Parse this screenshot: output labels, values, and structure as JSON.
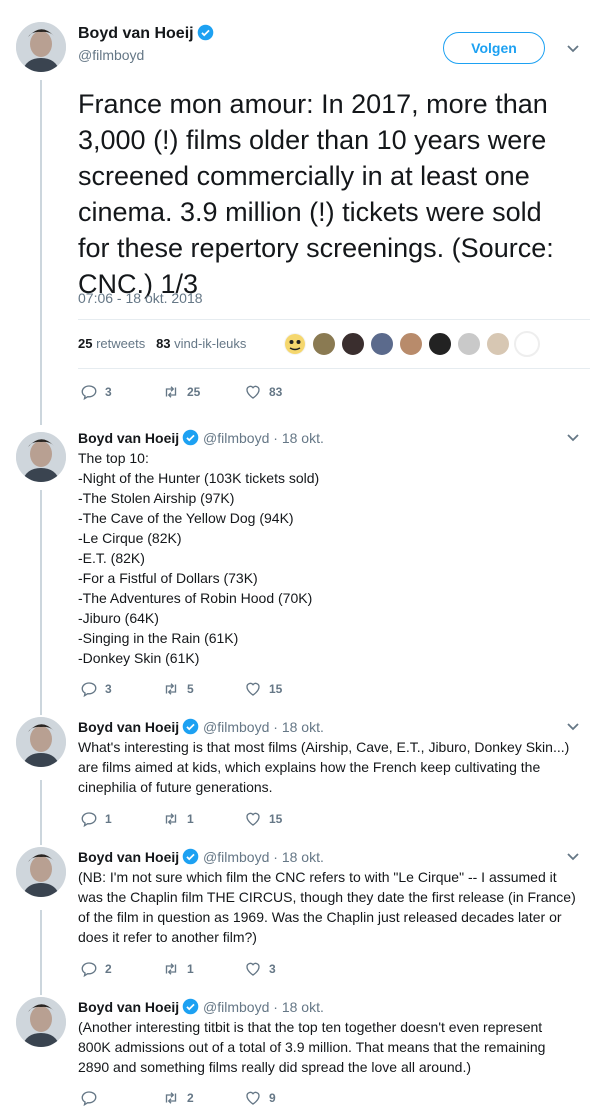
{
  "main_tweet": {
    "author_name": "Boyd van Hoeij",
    "author_handle": "@filmboyd",
    "follow_label": "Volgen",
    "text": "France mon amour: In 2017, more than 3,000 (!) films older than 10 years were screened commercially in at least one cinema. 3.9 million (!) tickets were sold for these repertory screenings. (Source: CNC.) 1/3",
    "timestamp": "07:06 - 18 okt. 2018",
    "retweets_count": "25",
    "retweets_label": "retweets",
    "likes_count": "83",
    "likes_label": "vind-ik-leuks",
    "actions": {
      "replies": "3",
      "retweets": "25",
      "likes": "83"
    }
  },
  "replies": [
    {
      "author_name": "Boyd van Hoeij",
      "author_handle": "@filmboyd",
      "date": "· 18 okt.",
      "lines": [
        "The top 10:",
        "-Night of the Hunter (103K tickets sold)",
        "-The Stolen Airship (97K)",
        "-The Cave of the Yellow Dog (94K)",
        "-Le Cirque (82K)",
        "-E.T. (82K)",
        "-For a Fistful of Dollars (73K)",
        "-The Adventures of Robin Hood (70K)",
        "-Jiburo (64K)",
        "-Singing in the Rain (61K)",
        "-Donkey Skin (61K)"
      ],
      "actions": {
        "replies": "3",
        "retweets": "5",
        "likes": "15"
      }
    },
    {
      "author_name": "Boyd van Hoeij",
      "author_handle": "@filmboyd",
      "date": "· 18 okt.",
      "lines": [
        "What's interesting is that most films (Airship, Cave, E.T., Jiburo, Donkey Skin...)",
        "are films aimed at kids, which explains how the French keep cultivating the",
        "cinephilia of future generations."
      ],
      "actions": {
        "replies": "1",
        "retweets": "1",
        "likes": "15"
      }
    },
    {
      "author_name": "Boyd van Hoeij",
      "author_handle": "@filmboyd",
      "date": "· 18 okt.",
      "lines": [
        "(NB: I'm not sure which film the CNC refers to with \"Le Cirque\" -- I assumed it",
        "was the Chaplin film THE CIRCUS, though they date the first release (in France)",
        "of the film in question as 1969. Was the Chaplin just released decades later or",
        "does it refer to another film?)"
      ],
      "actions": {
        "replies": "2",
        "retweets": "1",
        "likes": "3"
      }
    },
    {
      "author_name": "Boyd van Hoeij",
      "author_handle": "@filmboyd",
      "date": "· 18 okt.",
      "lines": [
        "(Another interesting titbit is that the top ten together doesn't even represent",
        "800K admissions out of a total of 3.9 million. That means that the remaining",
        "2890 and something films really did spread the love all around.)"
      ],
      "actions": {
        "replies": "",
        "retweets": "2",
        "likes": "9"
      }
    }
  ],
  "colors": {
    "accent": "#1da1f2",
    "muted": "#657786",
    "text": "#14171a",
    "divider": "#e6ecf0",
    "thread": "#ccd6dd"
  }
}
